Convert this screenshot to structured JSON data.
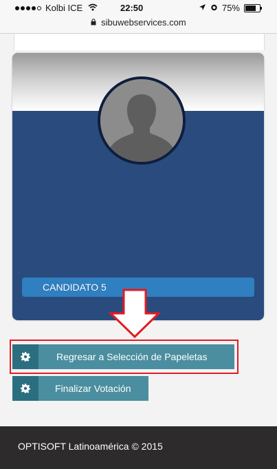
{
  "status_bar": {
    "carrier": "Kolbi ICE",
    "time": "22:50",
    "battery_text": "75%",
    "battery_level": 0.75,
    "signal_icon": "signal-dots-icon",
    "wifi_icon": "wifi-icon",
    "location_icon": "location-arrow-icon",
    "alarm_icon": "alarm-icon"
  },
  "browser": {
    "url": "sibuwebservices.com",
    "lock_icon": "lock-icon"
  },
  "candidate": {
    "name": "CANDIDATO 5",
    "avatar_icon": "person-silhouette-icon"
  },
  "actions": {
    "back_label": "Regresar a Selección de Papeletas",
    "finish_label": "Finalizar Votación",
    "button_icon": "gear-icon"
  },
  "annotation": {
    "arrow_icon": "down-arrow-icon",
    "arrow_color": "#e21b22",
    "frame_color": "#e21b22"
  },
  "footer": {
    "text": "OPTISOFT Latinoamérica © 2015"
  },
  "colors": {
    "card_blue": "#2a4b7e",
    "candidate_bar": "#2f7fc1",
    "button_teal": "#4a8e9f",
    "footer_dark": "#2d2b2b"
  }
}
